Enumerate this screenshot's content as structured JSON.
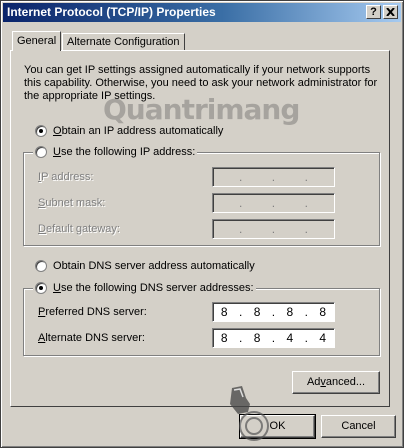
{
  "window": {
    "title": "Internet Protocol (TCP/IP) Properties",
    "help_glyph": "?",
    "close_glyph": "x"
  },
  "tabs": [
    {
      "label": "General",
      "active": true
    },
    {
      "label": "Alternate Configuration",
      "active": false
    }
  ],
  "description": "You can get IP settings assigned automatically if your network supports this capability. Otherwise, you need to ask your network administrator for the appropriate IP settings.",
  "ip_section": {
    "obtain_auto": {
      "mnemonic": "O",
      "rest": "btain an IP address automatically",
      "checked": true
    },
    "use_following": {
      "pre": "U",
      "rest": "se the following IP address:",
      "checked": false
    },
    "fields": [
      {
        "mnemonic": "I",
        "rest": "P address:",
        "octets": [
          "",
          "",
          "",
          ""
        ]
      },
      {
        "mnemonic": "",
        "pre": "S",
        "rest": "ubnet mask:",
        "octets": [
          "",
          "",
          "",
          ""
        ]
      },
      {
        "mnemonic": "",
        "pre": "D",
        "rest": "efault gateway:",
        "octets": [
          "",
          "",
          "",
          ""
        ]
      }
    ]
  },
  "dns_section": {
    "obtain_auto": {
      "pre": "O",
      "rest": "btain DNS server address automatically",
      "checked": false
    },
    "use_following": {
      "pre": "U",
      "rest": "se the following DNS server addresses:",
      "checked": true
    },
    "preferred": {
      "pre": "P",
      "rest": "referred DNS server:",
      "octets": [
        "8",
        "8",
        "8",
        "8"
      ]
    },
    "alternate": {
      "pre": "A",
      "rest": "lternate DNS server:",
      "octets": [
        "8",
        "8",
        "4",
        "4"
      ]
    }
  },
  "buttons": {
    "advanced": {
      "pre": "Ad",
      "u": "v",
      "rest": "anced..."
    },
    "ok": "OK",
    "cancel": "Cancel"
  },
  "watermark": "Quantrimang"
}
